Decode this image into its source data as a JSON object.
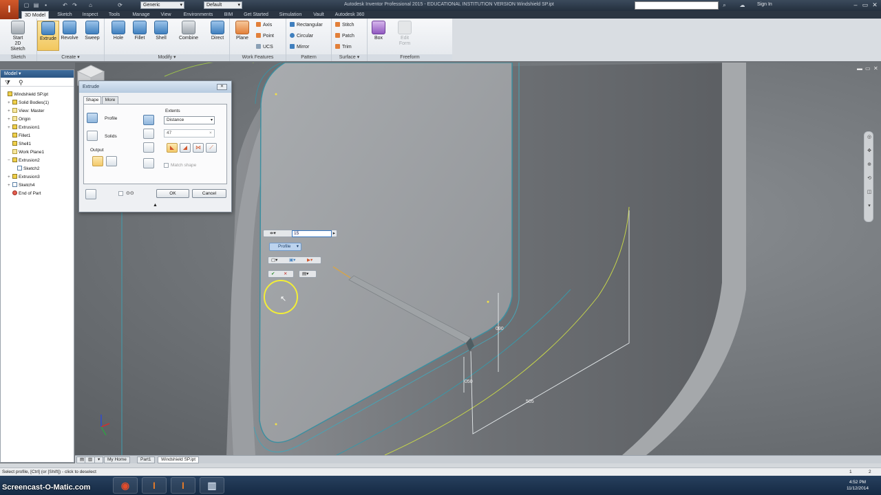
{
  "title_bar": {
    "app_button": "I",
    "appearance_select": "Generic",
    "style_select": "Default",
    "window_title": "Autodesk Inventor Professional 2015 - EDUCATIONAL INSTITUTION VERSION    Windshield SP.ipt",
    "sign_in": "Sign In"
  },
  "ribbon_tabs": [
    "3D Model",
    "Sketch",
    "Inspect",
    "Tools",
    "Manage",
    "View",
    "Environments",
    "BIM",
    "Get Started",
    "Simulation",
    "Vault",
    "Autodesk 360"
  ],
  "ribbon": {
    "sketch_panel": {
      "label": "Sketch",
      "start_sketch": "Start\n2D Sketch"
    },
    "create_panel": {
      "label": "Create ▾",
      "buttons": [
        "Extrude",
        "Revolve",
        "Sweep"
      ]
    },
    "modify_panel": {
      "label": "Modify ▾",
      "buttons": [
        "Hole",
        "Fillet",
        "Shell",
        "Combine",
        "Direct"
      ]
    },
    "work_features_panel": {
      "label": "Work Features",
      "plane": "Plane",
      "axis": "Axis",
      "point": "Point",
      "ucs": "UCS"
    },
    "pattern_panel": {
      "label": "Pattern",
      "rectangular": "Rectangular",
      "circular": "Circular",
      "mirror": "Mirror"
    },
    "surface_panel": {
      "label": "Surface ▾",
      "stitch": "Stitch",
      "patch": "Patch",
      "trim": "Trim"
    },
    "freeform_panel": {
      "label": "Freeform",
      "box": "Box",
      "edit_form": "Edit\nForm"
    }
  },
  "browser": {
    "header": "Model ▾",
    "items": [
      {
        "label": "Windshield SP.ipt",
        "indent": 0,
        "expander": ""
      },
      {
        "label": "Solid Bodies(1)",
        "indent": 1,
        "expander": "+"
      },
      {
        "label": "View: Master",
        "indent": 1,
        "expander": "+"
      },
      {
        "label": "Origin",
        "indent": 1,
        "expander": "+"
      },
      {
        "label": "Extrusion1",
        "indent": 1,
        "expander": "+"
      },
      {
        "label": "Fillet1",
        "indent": 1,
        "expander": ""
      },
      {
        "label": "Shell1",
        "indent": 1,
        "expander": ""
      },
      {
        "label": "Work Plane1",
        "indent": 1,
        "expander": ""
      },
      {
        "label": "Extrusion2",
        "indent": 1,
        "expander": "−"
      },
      {
        "label": "Sketch2",
        "indent": 2,
        "expander": ""
      },
      {
        "label": "Extrusion3",
        "indent": 1,
        "expander": "+"
      },
      {
        "label": "Sketch4",
        "indent": 1,
        "expander": "+"
      },
      {
        "label": "End of Part",
        "indent": 1,
        "expander": ""
      }
    ]
  },
  "extrude_dialog": {
    "title": "Extrude",
    "tabs": [
      "Shape",
      "More"
    ],
    "profile_label": "Profile",
    "solids_label": "Solids",
    "output_label": "Output",
    "extents_label": "Extents",
    "extents_value": "Distance",
    "distance_value": "47",
    "match_shape": "Match shape",
    "ok": "OK",
    "cancel": "Cancel"
  },
  "mini_toolbar": {
    "distance_value": "15",
    "profile_button": "Profile"
  },
  "dimensions": [
    "090",
    "050",
    "505"
  ],
  "document_tabs": [
    "My Home",
    "Part1",
    "Windshield SP.ipt"
  ],
  "status": {
    "prompt": "Select profile, [Ctrl] (or [Shift]) - click to deselect",
    "count_a": "1",
    "count_b": "2"
  },
  "taskbar": {
    "watermark": "Screencast-O-Matic.com",
    "time": "4:52 PM",
    "date": "11/12/2014"
  }
}
